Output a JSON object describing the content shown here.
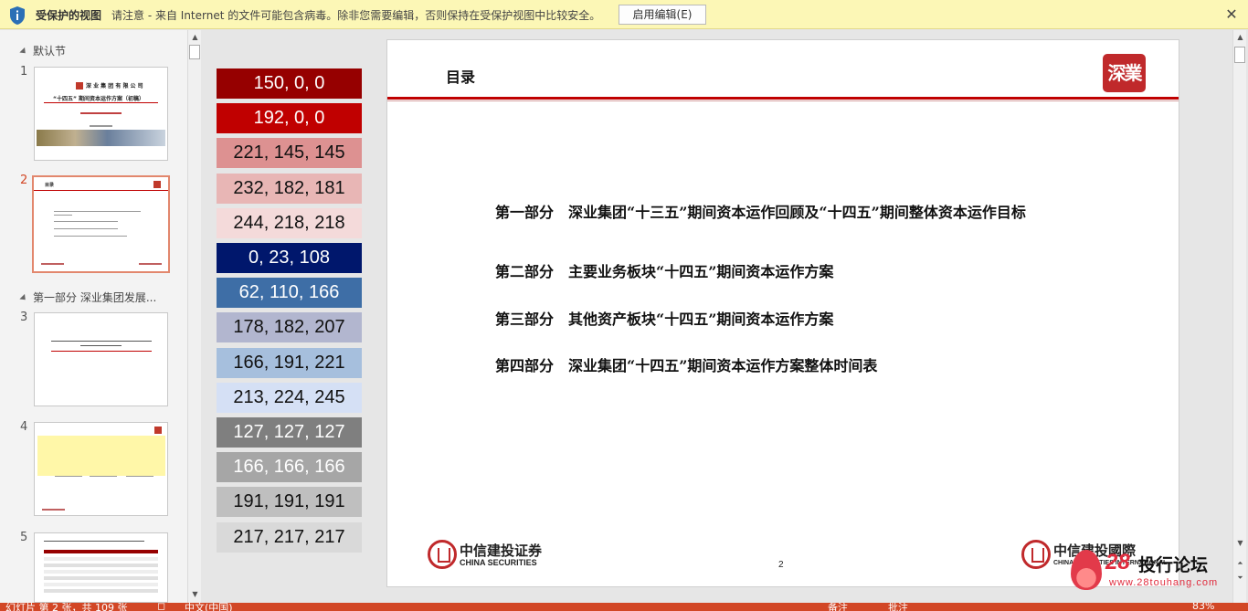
{
  "protected_view": {
    "title": "受保护的视图",
    "message": "请注意 - 来自 Internet 的文件可能包含病毒。除非您需要编辑，否则保持在受保护视图中比较安全。",
    "enable_button": "启用编辑(E)",
    "close": "✕",
    "colors": {
      "background": "#fcf7b6",
      "shield": "#2b6fb6"
    }
  },
  "thumbnails": {
    "sections": [
      "默认节",
      "第一部分 深业集团发展..."
    ],
    "slide_numbers": [
      "1",
      "2",
      "3",
      "4",
      "5"
    ],
    "active_slide": "2",
    "slide1": {
      "company": "深 业 集 团 有 限 公 司",
      "title": "“十四五” 期间资本运作方案（初稿）"
    },
    "slide2": {
      "title": "目录"
    }
  },
  "swatches": [
    {
      "label": "150, 0, 0",
      "bg": "#960000",
      "fg": "#ffffff"
    },
    {
      "label": "192, 0, 0",
      "bg": "#c00000",
      "fg": "#ffffff"
    },
    {
      "label": "221, 145, 145",
      "bg": "#dd9191",
      "fg": "#111111"
    },
    {
      "label": "232, 182, 181",
      "bg": "#e8b6b5",
      "fg": "#111111"
    },
    {
      "label": "244, 218, 218",
      "bg": "#f4dada",
      "fg": "#111111"
    },
    {
      "label": "0, 23, 108",
      "bg": "#00176c",
      "fg": "#ffffff"
    },
    {
      "label": "62, 110, 166",
      "bg": "#3e6ea6",
      "fg": "#ffffff"
    },
    {
      "label": "178, 182, 207",
      "bg": "#b2b6cf",
      "fg": "#111111"
    },
    {
      "label": "166, 191, 221",
      "bg": "#a6bfdd",
      "fg": "#111111"
    },
    {
      "label": "213, 224, 245",
      "bg": "#d5e0f5",
      "fg": "#111111"
    },
    {
      "label": "127, 127, 127",
      "bg": "#7f7f7f",
      "fg": "#ffffff"
    },
    {
      "label": "166, 166, 166",
      "bg": "#a6a6a6",
      "fg": "#ffffff"
    },
    {
      "label": "191, 191, 191",
      "bg": "#bfbfbf",
      "fg": "#111111"
    },
    {
      "label": "217, 217, 217",
      "bg": "#d9d9d9",
      "fg": "#111111"
    }
  ],
  "slide": {
    "title": "目录",
    "seal_text": "深業",
    "toc": [
      "第一部分　深业集团“十三五”期间资本运作回顾及“十四五”期间整体资本运作目标",
      "第二部分　主要业务板块“十四五”期间资本运作方案",
      "第三部分　其他资产板块“十四五”期间资本运作方案",
      "第四部分　深业集团“十四五”期间资本运作方案整体时间表"
    ],
    "logo_left": {
      "cn": "中信建投证券",
      "en": "CHINA SECURITIES"
    },
    "logo_right": {
      "cn": "中信建投國際",
      "en": "CHINA SECURITIES INTERNATIONAL"
    },
    "page_number": "2",
    "accent": "#c00000"
  },
  "watermark": {
    "number": "28",
    "text": "投行论坛",
    "url": "www.28touhang.com"
  },
  "status_bar": {
    "slide_info": "幻灯片 第 2 张，共 109 张",
    "language": "中文(中国)",
    "notes": "备注",
    "comments": "批注",
    "zoom": "83%",
    "color": "#d24726"
  }
}
